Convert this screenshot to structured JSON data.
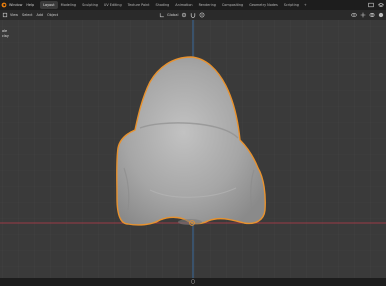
{
  "menu": {
    "items": [
      {
        "label": "Window"
      },
      {
        "label": "Help"
      }
    ]
  },
  "workspace_tabs": [
    {
      "label": "Layout",
      "active": true
    },
    {
      "label": "Modeling",
      "active": false
    },
    {
      "label": "Sculpting",
      "active": false
    },
    {
      "label": "UV Editing",
      "active": false
    },
    {
      "label": "Texture Paint",
      "active": false
    },
    {
      "label": "Shading",
      "active": false
    },
    {
      "label": "Animation",
      "active": false
    },
    {
      "label": "Rendering",
      "active": false
    },
    {
      "label": "Compositing",
      "active": false
    },
    {
      "label": "Geometry Nodes",
      "active": false
    },
    {
      "label": "Scripting",
      "active": false
    }
  ],
  "tab_add_label": "+",
  "header": {
    "items": [
      {
        "label": "View"
      },
      {
        "label": "Select"
      },
      {
        "label": "Add"
      },
      {
        "label": "Object"
      }
    ],
    "transform_orientation": "Global"
  },
  "viewport": {
    "overlay_line1": "ale",
    "overlay_line2": "clay"
  },
  "icons": {
    "app_logo": "blender-logo-icon",
    "scene": "scene-icon",
    "view_layer": "view-layer-icon",
    "mode": "object-mode-icon",
    "orientation": "transform-orientation-icon",
    "pivot": "pivot-point-icon",
    "snap": "magnet-icon",
    "proportional": "proportional-edit-icon",
    "visibility": "eye-icon",
    "gizmo": "gizmo-icon",
    "overlay": "overlay-icon",
    "shading": "shading-sphere-icon"
  },
  "colors": {
    "viewport_bg": "#3a3a3a",
    "grid": "#434343",
    "x_axis": "#9b3b45",
    "y_axis": "#3a6fa8",
    "selection_outline": "#e8922e",
    "mesh": "#a8a8a8"
  }
}
